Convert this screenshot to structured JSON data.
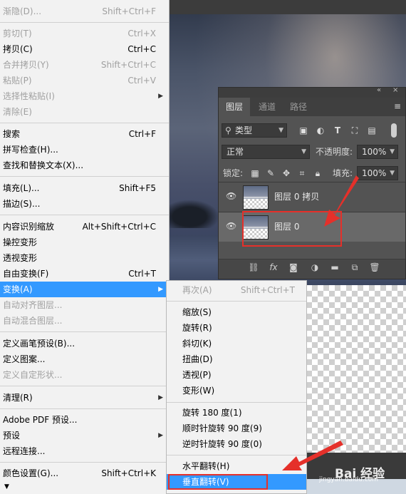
{
  "edit_menu": {
    "items": [
      {
        "label": "渐隐(D)...",
        "shortcut": "Shift+Ctrl+F",
        "disabled": true
      },
      {
        "label": "剪切(T)",
        "shortcut": "Ctrl+X",
        "disabled": true
      },
      {
        "label": "拷贝(C)",
        "shortcut": "Ctrl+C",
        "disabled": false
      },
      {
        "label": "合并拷贝(Y)",
        "shortcut": "Shift+Ctrl+C",
        "disabled": true
      },
      {
        "label": "粘贴(P)",
        "shortcut": "Ctrl+V",
        "disabled": true
      },
      {
        "label": "选择性粘贴(I)",
        "shortcut": "",
        "disabled": true
      },
      {
        "label": "清除(E)",
        "shortcut": "",
        "disabled": true
      },
      {
        "label": "搜索",
        "shortcut": "Ctrl+F",
        "disabled": false
      },
      {
        "label": "拼写检查(H)...",
        "shortcut": "",
        "disabled": false
      },
      {
        "label": "查找和替换文本(X)...",
        "shortcut": "",
        "disabled": false
      },
      {
        "label": "填充(L)...",
        "shortcut": "Shift+F5",
        "disabled": false
      },
      {
        "label": "描边(S)...",
        "shortcut": "",
        "disabled": false
      },
      {
        "label": "内容识别缩放",
        "shortcut": "Alt+Shift+Ctrl+C",
        "disabled": false
      },
      {
        "label": "操控变形",
        "shortcut": "",
        "disabled": false
      },
      {
        "label": "透视变形",
        "shortcut": "",
        "disabled": false
      },
      {
        "label": "自由变换(F)",
        "shortcut": "Ctrl+T",
        "disabled": false
      },
      {
        "label": "变换(A)",
        "shortcut": "",
        "disabled": false
      },
      {
        "label": "自动对齐图层...",
        "shortcut": "",
        "disabled": true
      },
      {
        "label": "自动混合图层...",
        "shortcut": "",
        "disabled": true
      },
      {
        "label": "定义画笔预设(B)...",
        "shortcut": "",
        "disabled": false
      },
      {
        "label": "定义图案...",
        "shortcut": "",
        "disabled": false
      },
      {
        "label": "定义自定形状...",
        "shortcut": "",
        "disabled": true
      },
      {
        "label": "清理(R)",
        "shortcut": "",
        "disabled": false
      },
      {
        "label": "Adobe PDF 预设...",
        "shortcut": "",
        "disabled": false
      },
      {
        "label": "预设",
        "shortcut": "",
        "disabled": false
      },
      {
        "label": "远程连接...",
        "shortcut": "",
        "disabled": false
      },
      {
        "label": "颜色设置(G)...",
        "shortcut": "Shift+Ctrl+K",
        "disabled": false
      }
    ]
  },
  "transform_submenu": {
    "items": [
      {
        "label": "再次(A)",
        "shortcut": "Shift+Ctrl+T",
        "disabled": true
      },
      {
        "label": "缩放(S)",
        "shortcut": ""
      },
      {
        "label": "旋转(R)",
        "shortcut": ""
      },
      {
        "label": "斜切(K)",
        "shortcut": ""
      },
      {
        "label": "扭曲(D)",
        "shortcut": ""
      },
      {
        "label": "透视(P)",
        "shortcut": ""
      },
      {
        "label": "变形(W)",
        "shortcut": ""
      },
      {
        "label": "旋转 180 度(1)",
        "shortcut": ""
      },
      {
        "label": "顺时针旋转 90 度(9)",
        "shortcut": ""
      },
      {
        "label": "逆时针旋转 90 度(0)",
        "shortcut": ""
      },
      {
        "label": "水平翻转(H)",
        "shortcut": ""
      },
      {
        "label": "垂直翻转(V)",
        "shortcut": ""
      }
    ]
  },
  "layers_panel": {
    "tabs": [
      "图层",
      "通道",
      "路径"
    ],
    "filter_kind": "类型",
    "blend_mode": "正常",
    "opacity_label": "不透明度:",
    "opacity_value": "100%",
    "lock_label": "锁定:",
    "fill_label": "填充:",
    "fill_value": "100%",
    "layers": [
      {
        "name": "图层 0 拷贝",
        "selected": false
      },
      {
        "name": "图层 0",
        "selected": true
      }
    ]
  },
  "watermark": {
    "text": "Bai 经验",
    "sub": "jingyan.baidu.com"
  },
  "colors": {
    "menu_bg": "#f2f2f2",
    "highlight": "#3399ff",
    "panel_bg": "#535353",
    "annotation": "#e5302a"
  }
}
